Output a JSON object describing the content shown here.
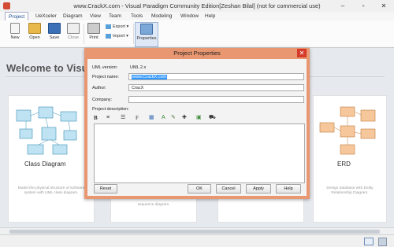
{
  "window": {
    "title": "www.CrackX.com - Visual Paradigm Community Edition[Zeshan Bilal] (not for commercial use)"
  },
  "menu": [
    "Project",
    "UeXceler",
    "Diagram",
    "View",
    "Team",
    "Tools",
    "Modeling",
    "Window",
    "Help"
  ],
  "ribbon": {
    "new": "New",
    "open": "Open",
    "save": "Save",
    "close": "Close",
    "print": "Print",
    "export": "Export",
    "import": "Import",
    "properties": "Properties",
    "more": "▾"
  },
  "welcome": "Welcome to Visu",
  "cards": [
    {
      "title": "Class Diagram",
      "desc": "Model the physical structure of software system with UML class diagram."
    },
    {
      "desc": "sequence diagram."
    },
    {
      "title": "ERD",
      "desc": "Design database with Entity Relationship Diagram."
    }
  ],
  "dialog": {
    "title": "Project Properties",
    "close": "✕",
    "uml_version_label": "UML version:",
    "uml_version_value": "UML 2.x",
    "project_name_label": "Project name:",
    "project_name_value": "www.CrackX.com",
    "author_label": "Author:",
    "author_value": "CracX",
    "company_label": "Company:",
    "company_value": "",
    "description_label": "Project description:",
    "buttons": {
      "reset": "Reset",
      "ok": "OK",
      "cancel": "Cancel",
      "apply": "Apply",
      "help": "Help"
    }
  },
  "toolbar": [
    "B",
    "≡",
    "☰",
    "F",
    "▦",
    "A",
    "✎",
    "✚",
    "▣",
    "⛟"
  ],
  "colors": {
    "dialog_frame": "#e89770",
    "close_button": "#d63a2a",
    "selection": "#3399ff",
    "accent": "#1a4c8a"
  }
}
